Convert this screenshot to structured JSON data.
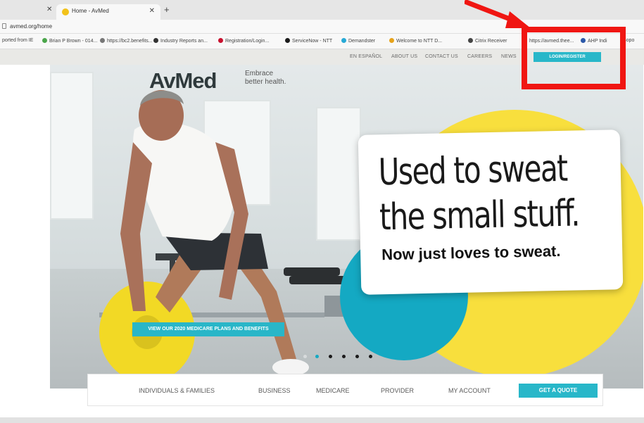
{
  "browser": {
    "tab_title": "Home - AvMed",
    "url": "avmed.org/home",
    "bookmarks": [
      "ported from IE",
      "Brian P Brown - 014...",
      "https://bc2.benefits...",
      "Industry Reports an...",
      "Registration/Login...",
      "ServiceNow - NTT",
      "Demandster",
      "Welcome to NTT D...",
      "Citrix Receiver",
      "https://avmed.thee...",
      "AHP Indi",
      "Sopo"
    ]
  },
  "topnav": {
    "items": [
      "EN ESPAÑOL",
      "ABOUT US",
      "CONTACT US",
      "CAREERS",
      "NEWS"
    ],
    "login_label": "LOGIN/REGISTER"
  },
  "logo": {
    "brand": "AvMed",
    "tagline_line1": "Embrace",
    "tagline_line2": "better health."
  },
  "hero": {
    "headline_line1": "Used to sweat",
    "headline_line2": "the small stuff.",
    "subline": "Now just loves to sweat.",
    "cta_label": "VIEW OUR 2020 MEDICARE PLANS AND BENEFITS",
    "slide_count": 6,
    "active_slide": 1
  },
  "bottom_nav": {
    "items": [
      "INDIVIDUALS & FAMILIES",
      "BUSINESS",
      "MEDICARE",
      "PROVIDER",
      "MY ACCOUNT"
    ],
    "quote_label": "GET A QUOTE"
  },
  "colors": {
    "accent_teal": "#28b7c9",
    "highlight_red": "#f01612",
    "yellow": "#f8df3d"
  }
}
